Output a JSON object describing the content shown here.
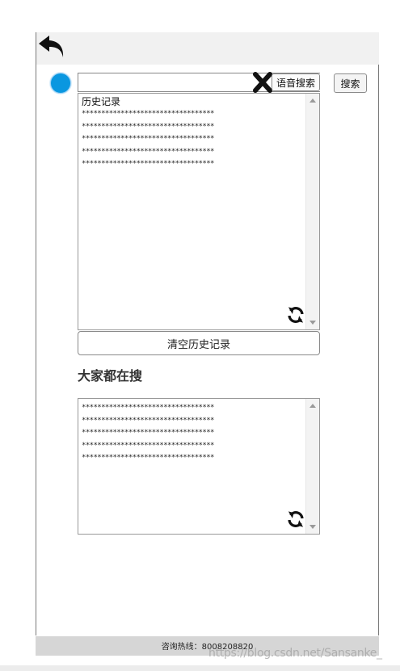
{
  "search": {
    "value": "",
    "placeholder": "",
    "voice_label": "语音搜索",
    "search_label": "搜索"
  },
  "history": {
    "heading": "历史记录",
    "items": [
      "**********************************",
      "**********************************",
      "**********************************",
      "**********************************",
      "**********************************"
    ],
    "clear_label": "清空历史记录"
  },
  "hot": {
    "title": "大家都在搜",
    "items": [
      "**********************************",
      "**********************************",
      "**********************************",
      "**********************************",
      "**********************************"
    ]
  },
  "footer": {
    "text": "咨询热线：8008208820"
  },
  "watermark": "https://blog.csdn.net/Sansanke_",
  "colors": {
    "accent_dot": "#0a97e0",
    "topbar": "#f1f1f1",
    "footer": "#d6d6d6"
  },
  "icons": {
    "back": "back-arrow-icon",
    "clear_input": "close-x-icon",
    "refresh": "refresh-icon"
  }
}
